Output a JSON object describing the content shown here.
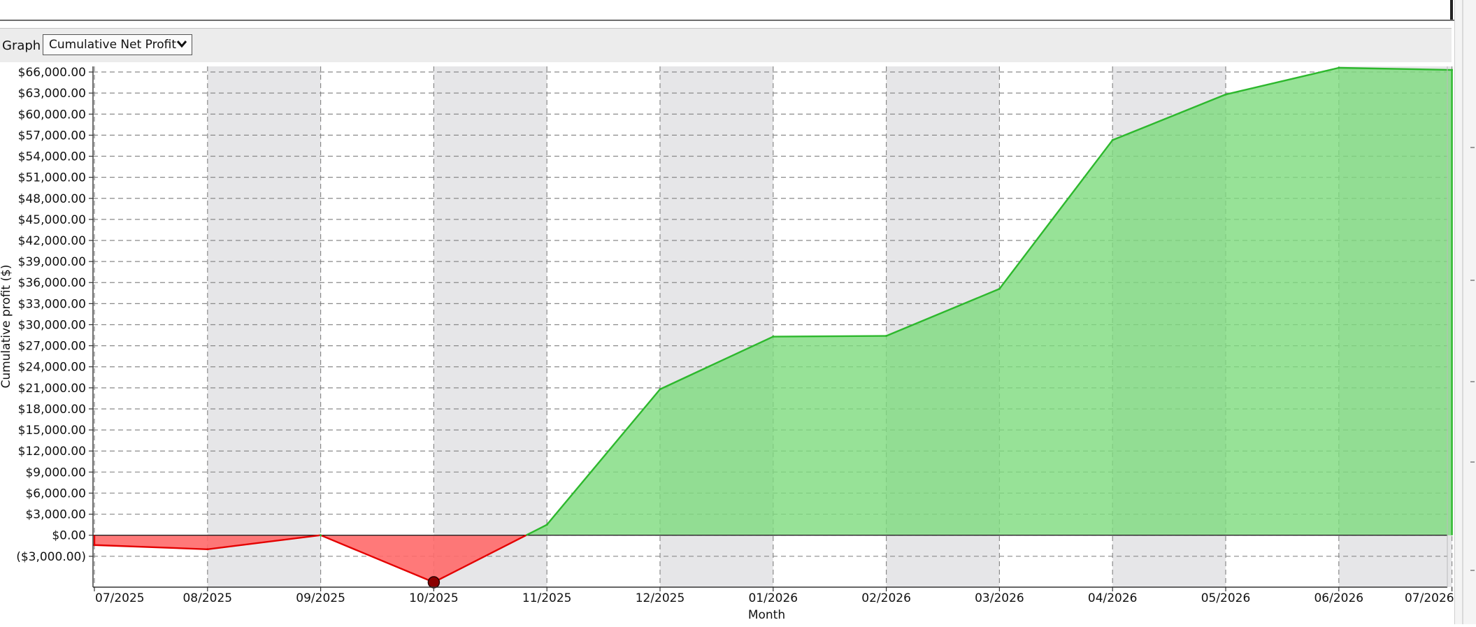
{
  "toolbar": {
    "graph_label": "Graph",
    "selected_graph": "Cumulative Net Profit"
  },
  "chart_data": {
    "type": "area",
    "title": "",
    "xlabel": "Month",
    "ylabel": "Cumulative profit ($)",
    "x_ticks": [
      "07/2025",
      "08/2025",
      "09/2025",
      "10/2025",
      "11/2025",
      "12/2025",
      "01/2026",
      "02/2026",
      "03/2026",
      "04/2026",
      "05/2026",
      "06/2026",
      "07/2026"
    ],
    "y_ticks": [
      -3000,
      0,
      3000,
      6000,
      9000,
      12000,
      15000,
      18000,
      21000,
      24000,
      27000,
      30000,
      33000,
      36000,
      39000,
      42000,
      45000,
      48000,
      51000,
      54000,
      57000,
      60000,
      63000,
      66000
    ],
    "y_tick_labels": [
      "($3,000.00)",
      "$0.00",
      "$3,000.00",
      "$6,000.00",
      "$9,000.00",
      "$12,000.00",
      "$15,000.00",
      "$18,000.00",
      "$21,000.00",
      "$24,000.00",
      "$27,000.00",
      "$30,000.00",
      "$33,000.00",
      "$36,000.00",
      "$39,000.00",
      "$42,000.00",
      "$45,000.00",
      "$48,000.00",
      "$51,000.00",
      "$54,000.00",
      "$57,000.00",
      "$60,000.00",
      "$63,000.00",
      "$66,000.00"
    ],
    "ylim": [
      -7400,
      66800
    ],
    "grid": true,
    "shaded_month_bands": [
      "08/2025",
      "10/2025",
      "12/2025",
      "02/2026",
      "04/2026",
      "06/2026"
    ],
    "series": [
      {
        "values": [
          {
            "x": "07/2025",
            "y": -1400
          },
          {
            "x": "08/2025",
            "y": -2000
          },
          {
            "x": "09/2025",
            "y": 0
          },
          {
            "x": "10/2025",
            "y": -6700
          },
          {
            "x": "11/2025",
            "y": 1500
          },
          {
            "x": "12/2025",
            "y": 20800
          },
          {
            "x": "01/2026",
            "y": 28300
          },
          {
            "x": "02/2026",
            "y": 28400
          },
          {
            "x": "03/2026",
            "y": 35100
          },
          {
            "x": "04/2026",
            "y": 56300
          },
          {
            "x": "05/2026",
            "y": 62800
          },
          {
            "x": "06/2026",
            "y": 66600
          },
          {
            "x": "07/2026",
            "y": 66300
          }
        ]
      }
    ],
    "marked_point": {
      "x": "10/2025",
      "y": -6700
    },
    "colors": {
      "positive_fill": "#7ddb7d",
      "positive_line": "#2db82d",
      "negative_fill": "#ff6a6a",
      "negative_line": "#e40000",
      "marker": "#8b0000",
      "band": "#e6e6e8",
      "grid": "#8a8a8a"
    }
  }
}
